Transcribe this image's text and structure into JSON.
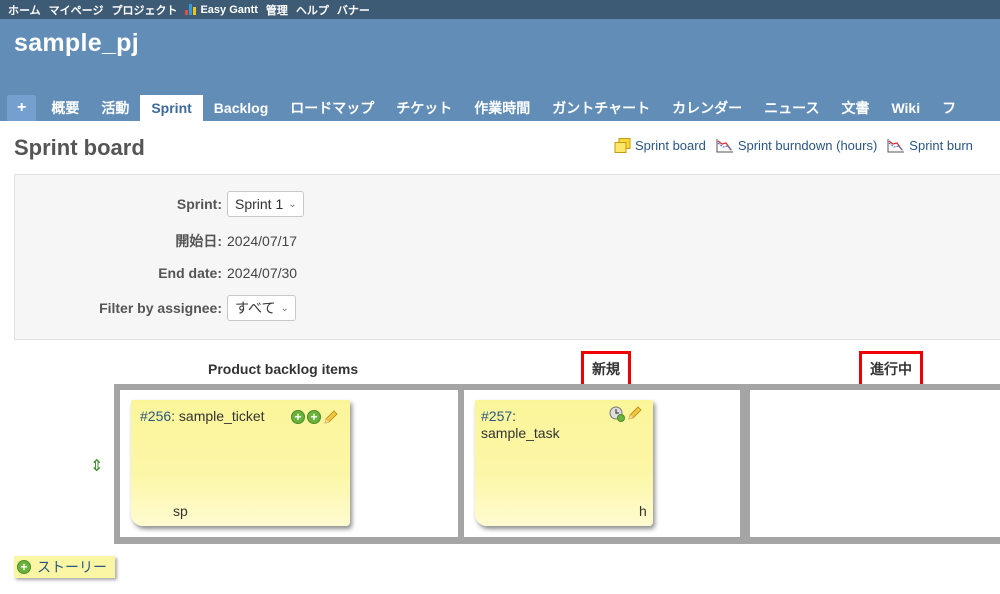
{
  "top_menu": [
    "ホーム",
    "マイページ",
    "プロジェクト",
    "Easy Gantt",
    "管理",
    "ヘルプ",
    "バナー"
  ],
  "project_title": "sample_pj",
  "tabs": [
    {
      "label": "+"
    },
    {
      "label": "概要"
    },
    {
      "label": "活動"
    },
    {
      "label": "Sprint"
    },
    {
      "label": "Backlog"
    },
    {
      "label": "ロードマップ"
    },
    {
      "label": "チケット"
    },
    {
      "label": "作業時間"
    },
    {
      "label": "ガントチャート"
    },
    {
      "label": "カレンダー"
    },
    {
      "label": "ニュース"
    },
    {
      "label": "文書"
    },
    {
      "label": "Wiki"
    },
    {
      "label": "フ"
    }
  ],
  "page_title": "Sprint board",
  "contextual_links": [
    "Sprint board",
    "Sprint burndown (hours)",
    "Sprint burn"
  ],
  "filters": {
    "sprint_label": "Sprint:",
    "sprint_value": "Sprint 1",
    "start_label": "開始日:",
    "start_value": "2024/07/17",
    "end_label": "End date:",
    "end_value": "2024/07/30",
    "assignee_label": "Filter by assignee:",
    "assignee_value": "すべて"
  },
  "board": {
    "columns": [
      "Product backlog items",
      "新規",
      "進行中"
    ],
    "story": {
      "id": "#256",
      "title": ": sample_ticket",
      "footer": "sp"
    },
    "task": {
      "id": "#257",
      "title": ":",
      "subtitle": "sample_task",
      "footer": "h"
    }
  },
  "add_story_label": "ストーリー",
  "colors": {
    "top_menu": "#3e5b76",
    "header": "#628db6",
    "highlight": "#e00000",
    "sticky": "#fcf7a8"
  }
}
